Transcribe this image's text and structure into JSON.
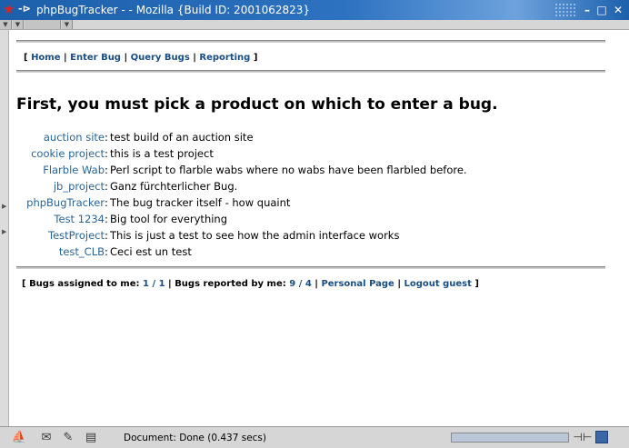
{
  "window": {
    "title": "phpBugTracker - - Mozilla {Build ID: 2001062823}",
    "icons": [
      "star-icon",
      "pin-icon"
    ],
    "controls": [
      "minimize-icon",
      "maximize-icon",
      "close-icon"
    ],
    "minimize_glyph": "–",
    "maximize_glyph": "□",
    "close_glyph": "✕"
  },
  "nav": {
    "open": "[",
    "sep": "|",
    "close": "]",
    "links": [
      "Home",
      "Enter Bug",
      "Query Bugs",
      "Reporting"
    ]
  },
  "heading": "First, you must pick a product on which to enter a bug.",
  "products": [
    {
      "name": "auction site",
      "description": "test build of an auction site"
    },
    {
      "name": "cookie project",
      "description": "this is a test project"
    },
    {
      "name": "Flarble Wab",
      "description": "Perl script to flarble wabs where no wabs have been flarbled before."
    },
    {
      "name": "jb_project",
      "description": "Ganz fürchterlicher Bug."
    },
    {
      "name": "phpBugTracker",
      "description": "The bug tracker itself - how quaint"
    },
    {
      "name": "Test 1234",
      "description": "Big tool for everything"
    },
    {
      "name": "TestProject",
      "description": "This is just a test to see how the admin interface works"
    },
    {
      "name": "test_CLB",
      "description": "Ceci est un test"
    }
  ],
  "footer": {
    "open": "[",
    "assigned_label": "Bugs assigned to me:",
    "assigned_open": "1",
    "assigned_sep": "/",
    "assigned_total": "1",
    "reported_label": "Bugs reported by me:",
    "reported_open": "9",
    "reported_sep": "/",
    "reported_total": "4",
    "personal_page": "Personal Page",
    "logout": "Logout guest",
    "sep": "|",
    "close": "]"
  },
  "status": {
    "text": "Document: Done (0.437 secs)",
    "icons": [
      "navigator-icon",
      "mail-icon",
      "composer-icon",
      "addressbook-icon"
    ],
    "progress_fraction": 1.0
  },
  "colors": {
    "titlebar": "#1c60ab",
    "link": "#1a4d82",
    "product_link": "#2a6496"
  }
}
